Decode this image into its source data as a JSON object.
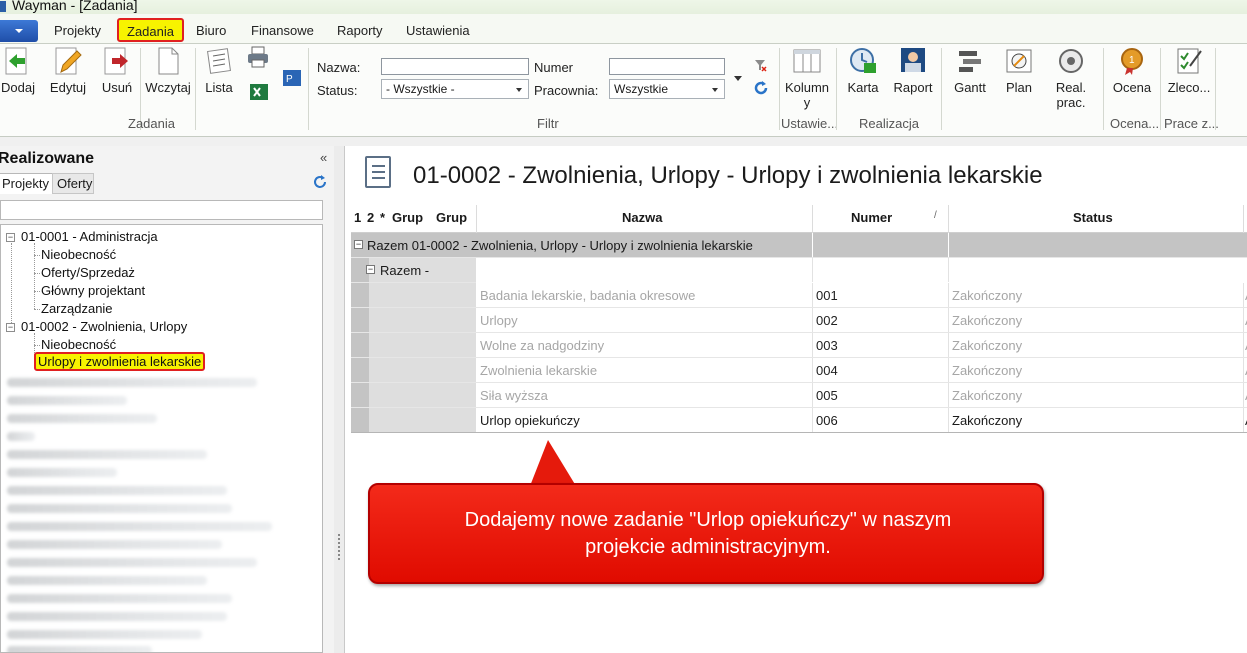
{
  "window": {
    "title": "Wayman - [Zadania]"
  },
  "menu": {
    "items": [
      "Projekty",
      "Zadania",
      "Biuro",
      "Finansowe",
      "Raporty",
      "Ustawienia"
    ]
  },
  "ribbon": {
    "buttons": {
      "add": "Dodaj",
      "edit": "Edytuj",
      "delete": "Usuń",
      "load": "Wczytaj",
      "list": "Lista",
      "columns_line1": "Kolumn",
      "columns_line2": "y",
      "card": "Karta",
      "report": "Raport",
      "gantt": "Gantt",
      "plan": "Plan",
      "real_line1": "Real.",
      "real_line2": "prac.",
      "rating": "Ocena",
      "orders": "Zleco..."
    },
    "groups": {
      "tasks": "Zadania",
      "filter": "Filtr",
      "settings": "Ustawie...",
      "realization": "Realizacja",
      "rating": "Ocena...",
      "work": "Prace z..."
    },
    "filter": {
      "name_label": "Nazwa:",
      "name_value": "",
      "status_label": "Status:",
      "status_value": "- Wszystkie -",
      "number_label": "Numer",
      "number_value": "",
      "workshop_label": "Pracownia:",
      "workshop_value": "Wszystkie"
    }
  },
  "left_panel": {
    "title": "Realizowane",
    "collapse": "«",
    "tabs": {
      "projects": "Projekty",
      "offers": "Oferty"
    },
    "tree": {
      "p1": "01-0001 - Administracja",
      "p1_children": [
        "Nieobecność",
        "Oferty/Sprzedaż",
        "Główny projektant",
        "Zarządzanie"
      ],
      "p2": "01-0002 - Zwolnienia, Urlopy",
      "p2_children": [
        "Nieobecność",
        "Urlopy i zwolnienia lekarskie"
      ]
    }
  },
  "main": {
    "title": "01-0002 - Zwolnienia, Urlopy - Urlopy i zwolnienia lekarskie",
    "grid": {
      "headers": {
        "c1": "1",
        "c2": "2",
        "c3": "*",
        "grp1": "Grup",
        "grp2": "Grup",
        "name": "Nazwa",
        "number": "Numer",
        "sort": "/",
        "status": "Status"
      },
      "group1": "Razem 01-0002 - Zwolnienia, Urlopy - Urlopy i zwolnienia lekarskie",
      "group2": "Razem -",
      "rows": [
        {
          "name": "Badania lekarskie, badania okresowe",
          "number": "001",
          "status": "Zakończony",
          "extra": "A"
        },
        {
          "name": "Urlopy",
          "number": "002",
          "status": "Zakończony",
          "extra": "A"
        },
        {
          "name": "Wolne za nadgodziny",
          "number": "003",
          "status": "Zakończony",
          "extra": "A"
        },
        {
          "name": "Zwolnienia lekarskie",
          "number": "004",
          "status": "Zakończony",
          "extra": "A"
        },
        {
          "name": "Siła wyższa",
          "number": "005",
          "status": "Zakończony",
          "extra": "A"
        },
        {
          "name": "Urlop opiekuńczy",
          "number": "006",
          "status": "Zakończony",
          "extra": "A"
        }
      ]
    }
  },
  "callout": {
    "line1": "Dodajemy nowe zadanie \"Urlop opiekuńczy\" w naszym",
    "line2": "projekcie administracyjnym."
  },
  "colors": {
    "highlight": "#f7f300",
    "highlight_border": "#e02020",
    "callout": "#e8160a"
  }
}
